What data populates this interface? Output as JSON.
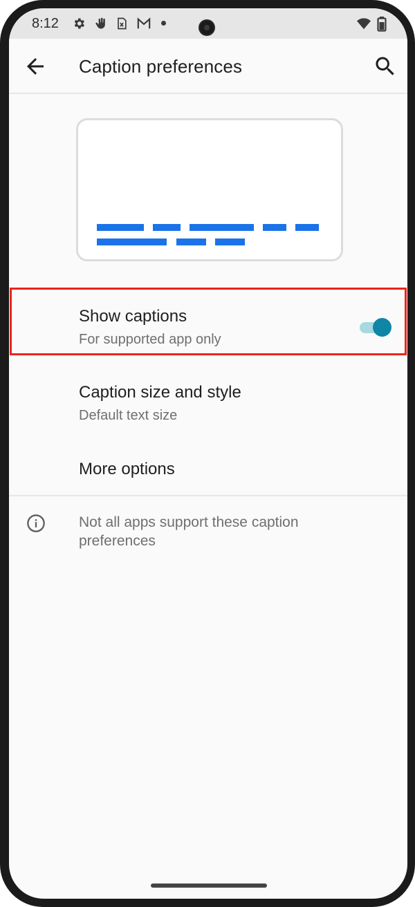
{
  "status_bar": {
    "time": "8:12",
    "icons": [
      "settings-icon",
      "hand-icon",
      "sim-card-icon",
      "gmail-icon",
      "dot-icon",
      "wifi-icon",
      "battery-icon"
    ]
  },
  "app_bar": {
    "title": "Caption preferences",
    "back_icon": "arrow-back-icon",
    "search_icon": "search-icon"
  },
  "settings": {
    "show_captions": {
      "title": "Show captions",
      "subtitle": "For supported app only",
      "enabled": true
    },
    "caption_size": {
      "title": "Caption size and style",
      "subtitle": "Default text size"
    },
    "more_options": {
      "title": "More options"
    }
  },
  "info": {
    "icon": "info-icon",
    "text": "Not all apps support these caption preferences"
  },
  "colors": {
    "caption_preview": "#1a73e8",
    "toggle_thumb": "#0f86a6",
    "toggle_track": "#a8d8e0",
    "highlight_border": "#e8261c"
  }
}
